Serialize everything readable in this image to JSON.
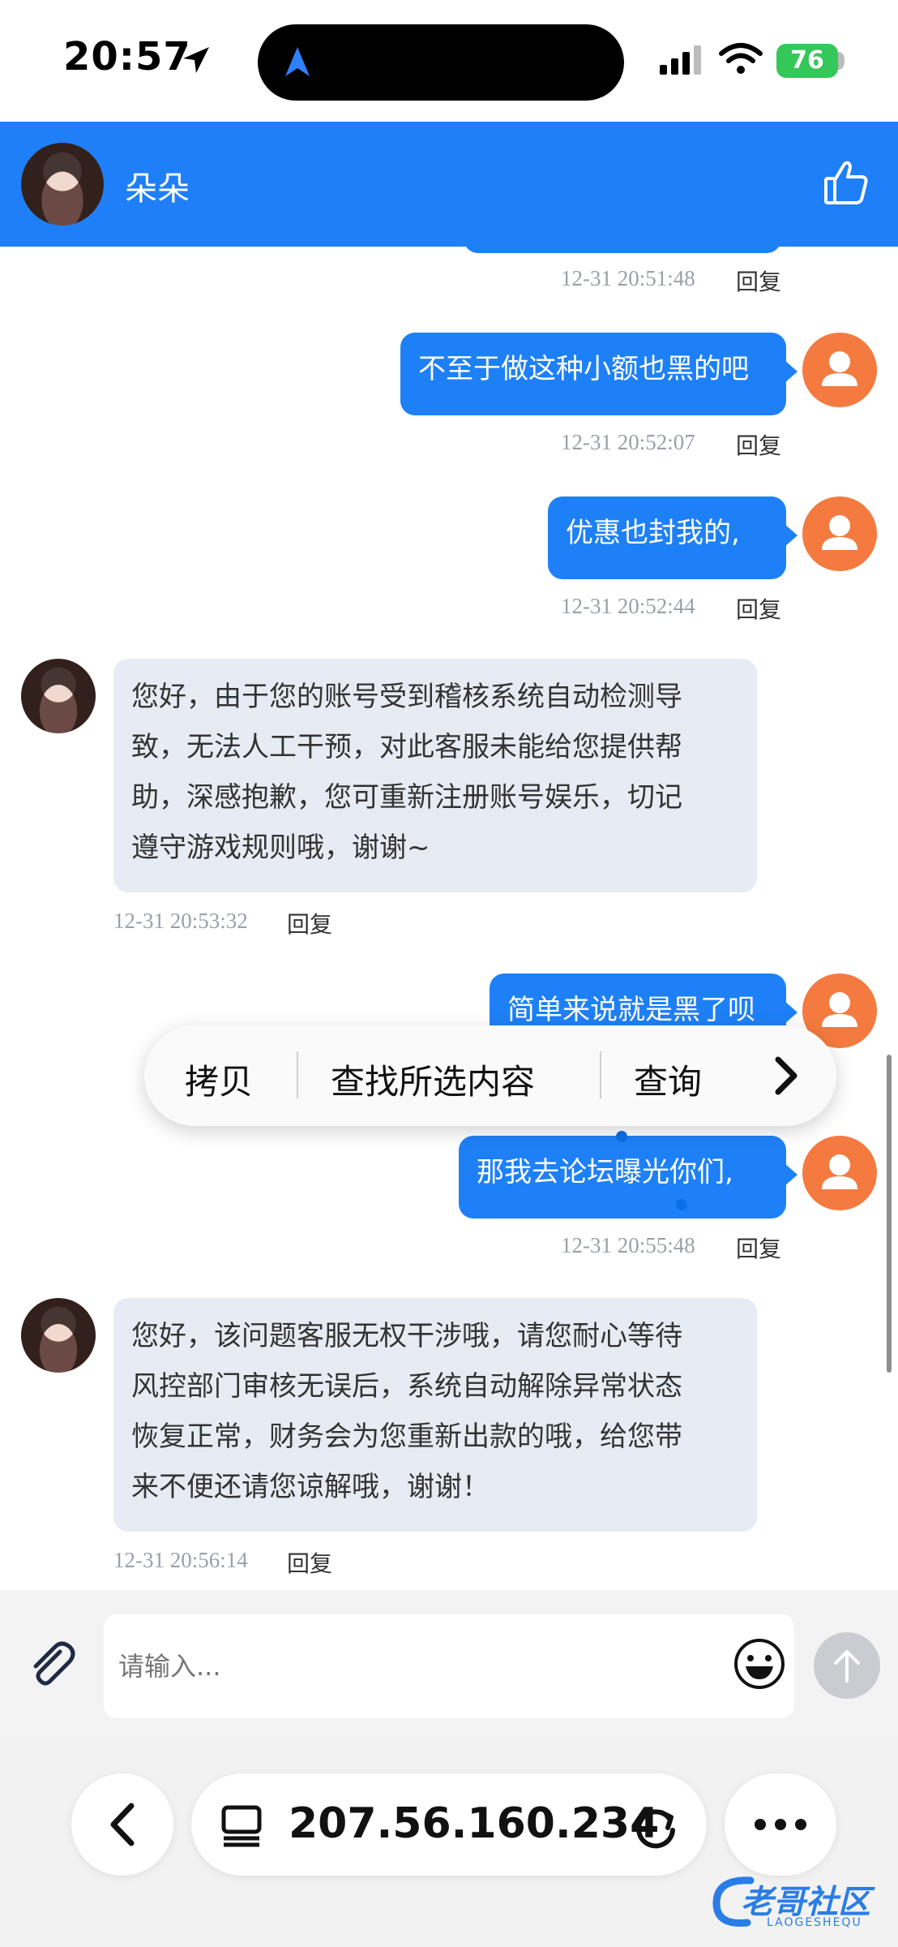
{
  "status_bar": {
    "time": "20:57",
    "battery": "76"
  },
  "header": {
    "contact_name": "朵朵",
    "like_icon": "thumbs-up-icon"
  },
  "messages": [
    {
      "dir": "out",
      "text": "",
      "timestamp": "12-31 20:51:48",
      "reply": "回复"
    },
    {
      "dir": "out",
      "text": "不至于做这种小额也黑的吧",
      "timestamp": "12-31 20:52:07",
      "reply": "回复"
    },
    {
      "dir": "out",
      "text": "优惠也封我的,",
      "timestamp": "12-31 20:52:44",
      "reply": "回复"
    },
    {
      "dir": "in",
      "lines": [
        "您好，由于您的账号受到稽核系统自动检测导",
        "致，无法人工干预，对此客服未能给您提供帮",
        "助，深感抱歉，您可重新注册账号娱乐，切记",
        "遵守游戏规则哦，谢谢~"
      ],
      "timestamp": "12-31 20:53:32",
      "reply": "回复"
    },
    {
      "dir": "out",
      "text": "简单来说就是黑了呗",
      "timestamp": "",
      "reply": ""
    },
    {
      "dir": "out",
      "text": "那我去论坛曝光你们,",
      "timestamp": "12-31 20:55:48",
      "reply": "回复"
    },
    {
      "dir": "in",
      "lines": [
        "您好，该问题客服无权干涉哦，请您耐心等待",
        "风控部门审核无误后，系统自动解除异常状态",
        "恢复正常，财务会为您重新出款的哦，给您带",
        "来不便还请您谅解哦，谢谢！"
      ],
      "timestamp": "12-31 20:56:14",
      "reply": "回复"
    }
  ],
  "context_menu": {
    "copy": "拷贝",
    "find": "查找所选内容",
    "lookup": "查询"
  },
  "input": {
    "placeholder": "请输入..."
  },
  "browser": {
    "address": "207.56.160.234"
  },
  "watermark": {
    "text": "老哥社区",
    "subtext": "LAOGESHEQU"
  },
  "colors": {
    "accent": "#1e7ff8",
    "outgoing_bubble": "#1e80f7",
    "incoming_bubble": "#e7ecf4",
    "user_avatar": "#f47a3f"
  }
}
